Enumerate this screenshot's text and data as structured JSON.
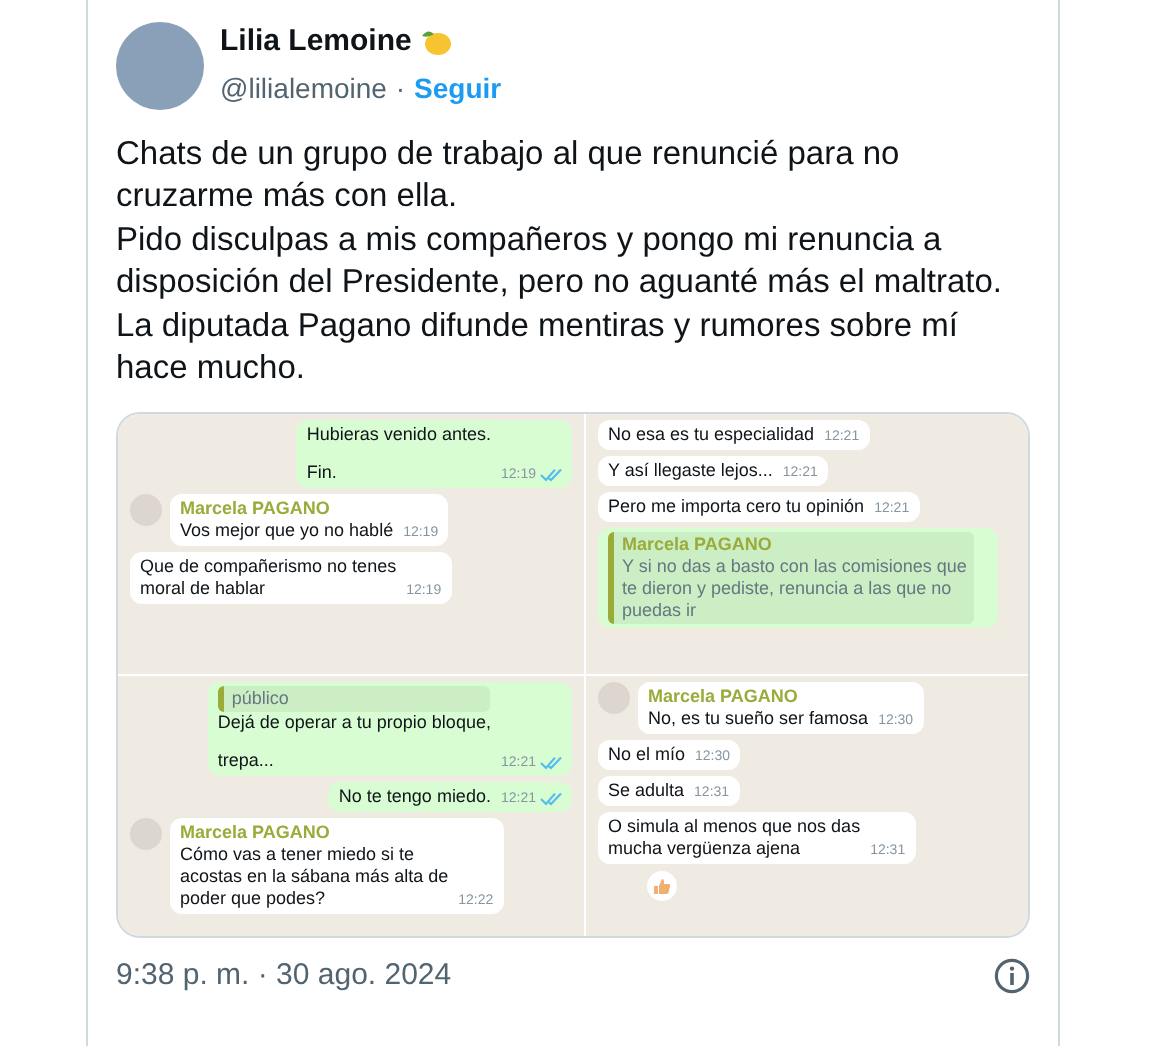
{
  "author": {
    "name": "Lilia Lemoine",
    "handle": "@lilialemoine",
    "separator": "·",
    "follow": "Seguir"
  },
  "text": [
    "Chats de un grupo de trabajo al que renuncié para no cruzarme más con ella.",
    "Pido disculpas a mis compañeros y pongo mi renuncia a disposición del Presidente, pero no aguanté más el maltrato.",
    "La diputada Pagano difunde mentiras y rumores sobre mí hace mucho."
  ],
  "chat_panels": [
    {
      "messages": [
        {
          "kind": "out",
          "lines": [
            "Hubieras venido antes.",
            "Fin."
          ],
          "time": "12:19",
          "read": true
        },
        {
          "kind": "in",
          "sender": "Marcela PAGANO",
          "lines": [
            "Vos mejor que yo no hablé"
          ],
          "time": "12:19"
        },
        {
          "kind": "in",
          "lines": [
            "Que de compañerismo no tenes",
            "moral de hablar"
          ],
          "time": "12:19"
        }
      ]
    },
    {
      "messages": [
        {
          "kind": "in",
          "lines": [
            "No esa es tu especialidad"
          ],
          "time": "12:21"
        },
        {
          "kind": "in",
          "lines": [
            "Y así llegaste lejos..."
          ],
          "time": "12:21"
        },
        {
          "kind": "in",
          "lines": [
            "Pero me importa cero tu opinión"
          ],
          "time": "12:21"
        },
        {
          "kind": "quote",
          "sender": "Marcela PAGANO",
          "lines": [
            "Y si no das a basto con las comisiones que",
            "te dieron y pediste, renuncia a las que no",
            "puedas ir"
          ]
        }
      ]
    },
    {
      "messages": [
        {
          "kind": "out",
          "quote": "público",
          "lines": [
            "Dejá de operar a tu propio bloque,",
            "trepa..."
          ],
          "time": "12:21",
          "read": true
        },
        {
          "kind": "out",
          "lines": [
            "No te tengo miedo."
          ],
          "time": "12:21",
          "read": true
        },
        {
          "kind": "in",
          "sender": "Marcela PAGANO",
          "lines": [
            "Cómo vas a tener miedo si te",
            "acostas en la sábana más alta de",
            "poder que podes?"
          ],
          "time": "12:22"
        }
      ]
    },
    {
      "messages": [
        {
          "kind": "in",
          "sender": "Marcela PAGANO",
          "lines": [
            "No, es tu sueño ser famosa"
          ],
          "time": "12:30"
        },
        {
          "kind": "in",
          "lines": [
            "No el mío"
          ],
          "time": "12:30"
        },
        {
          "kind": "in",
          "lines": [
            "Se adulta"
          ],
          "time": "12:31"
        },
        {
          "kind": "in",
          "lines": [
            "O simula al menos que nos das",
            "mucha vergüenza ajena"
          ],
          "time": "12:31",
          "reaction": true
        }
      ]
    }
  ],
  "timestamp": "9:38 p. m. · 30 ago. 2024"
}
